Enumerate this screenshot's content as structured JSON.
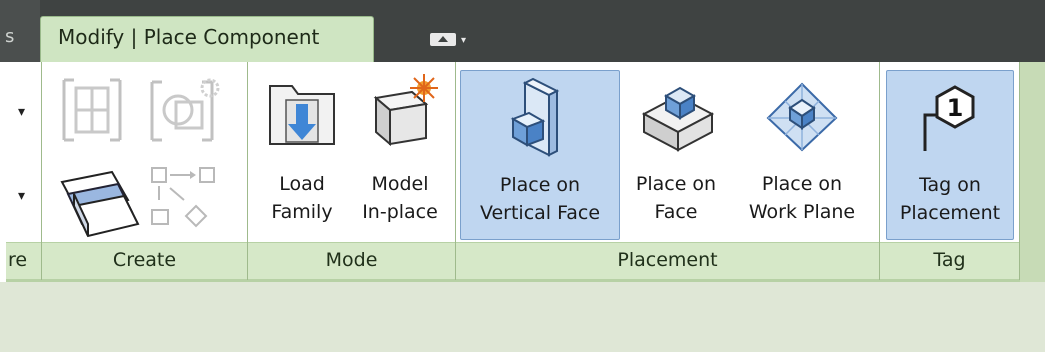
{
  "tabbar": {
    "partial_tab_char": "s",
    "active_tab": "Modify | Place Component",
    "qa_arrow": "▾"
  },
  "panels": {
    "partial": {
      "label": "re",
      "dropdown1": "▾",
      "dropdown2": "▾"
    },
    "create": {
      "label": "Create"
    },
    "mode": {
      "label": "Mode",
      "load_family": [
        "Load",
        "Family"
      ],
      "model_inplace": [
        "Model",
        "In-place"
      ]
    },
    "placement": {
      "label": "Placement",
      "vertical_face": [
        "Place on",
        "Vertical Face"
      ],
      "face": [
        "Place on",
        "Face"
      ],
      "work_plane": [
        "Place on",
        "Work Plane"
      ]
    },
    "tag": {
      "label": "Tag",
      "tag_on_placement": [
        "Tag on",
        "Placement"
      ],
      "tag_number": "1"
    }
  },
  "colors": {
    "tabbar_bg": "#3f4342",
    "active_tab_bg": "#cfe5c2",
    "active_button_bg": "#bfd6f0",
    "icon_blue": "#5b8fd0"
  }
}
